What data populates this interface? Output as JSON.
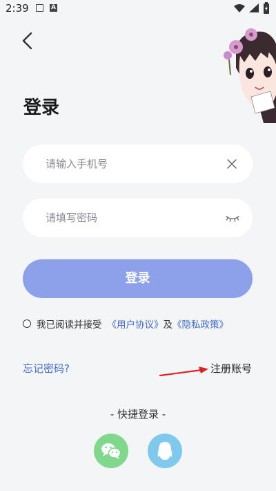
{
  "status_bar": {
    "time": "2:39"
  },
  "header": {
    "back_icon": "chevron-left-icon"
  },
  "page": {
    "title": "登录"
  },
  "form": {
    "phone_placeholder": "请输入手机号",
    "phone_value": "",
    "password_placeholder": "请填写密码",
    "password_value": "",
    "clear_icon": "close-icon",
    "visibility_icon": "eye-closed-icon"
  },
  "login_button": {
    "label": "登录",
    "color": "#8ca1ea"
  },
  "agreement": {
    "prefix": "我已阅读并接受",
    "user_agreement": "《用户协议》",
    "join": "及",
    "privacy_policy": "《隐私政策》"
  },
  "links": {
    "forgot_password": "忘记密码?",
    "register": "注册账号"
  },
  "quick_login": {
    "title": "- 快捷登录 -",
    "wechat_color": "#7fd88c",
    "qq_color": "#7fc8ee"
  },
  "colors": {
    "background": "#f4f5f7",
    "link": "#3f6bcf",
    "annotation_arrow": "#e02020"
  }
}
